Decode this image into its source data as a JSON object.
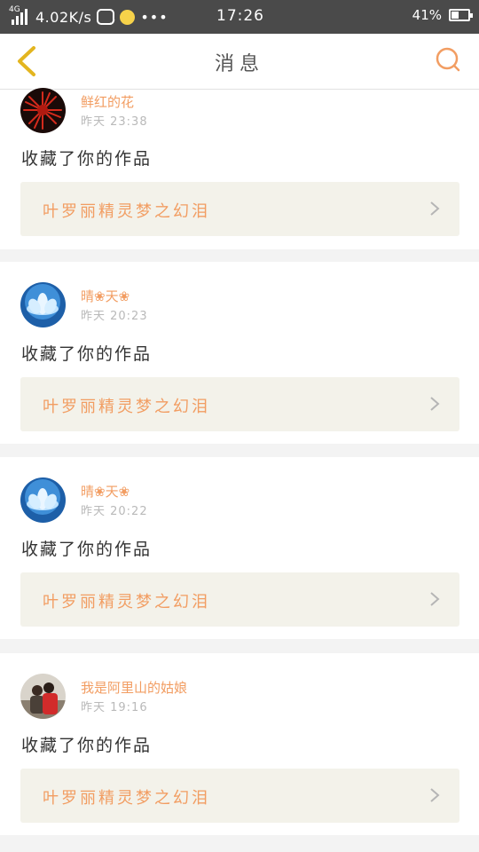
{
  "status_bar": {
    "network_type": "4G",
    "speed": "4.02K/s",
    "more": "•••",
    "time": "17:26",
    "battery_percent": "41%",
    "battery_level": 0.41
  },
  "header": {
    "title": "消息",
    "back_icon": "chevron-left-icon",
    "search_icon": "search-icon",
    "accent_color": "#f29d62"
  },
  "messages": [
    {
      "user": "鲜红的花",
      "time": "昨天 23:38",
      "action": "收藏了你的作品",
      "work_title": "叶罗丽精灵梦之幻泪",
      "avatar": "red-flower-avatar"
    },
    {
      "user": "晴❀天❀",
      "time": "昨天 20:23",
      "action": "收藏了你的作品",
      "work_title": "叶罗丽精灵梦之幻泪",
      "avatar": "blue-lotus-avatar"
    },
    {
      "user": "晴❀天❀",
      "time": "昨天 20:22",
      "action": "收藏了你的作品",
      "work_title": "叶罗丽精灵梦之幻泪",
      "avatar": "blue-lotus-avatar"
    },
    {
      "user": "我是阿里山的姑娘",
      "time": "昨天 19:16",
      "action": "收藏了你的作品",
      "work_title": "叶罗丽精灵梦之幻泪",
      "avatar": "people-photo-avatar"
    }
  ]
}
